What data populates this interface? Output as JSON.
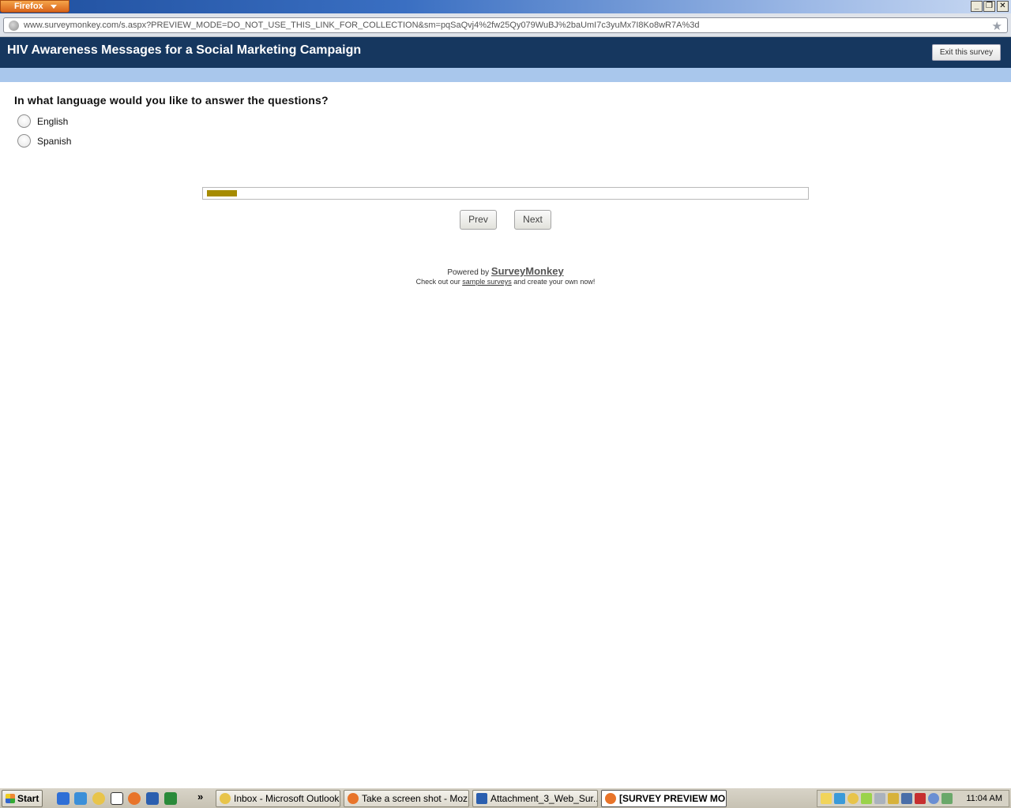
{
  "browser": {
    "menu_button": "Firefox",
    "url": "www.surveymonkey.com/s.aspx?PREVIEW_MODE=DO_NOT_USE_THIS_LINK_FOR_COLLECTION&sm=pqSaQvj4%2fw25Qy079WuBJ%2baUmI7c3yuMx7I8Ko8wR7A%3d",
    "window_controls": {
      "minimize": "_",
      "restore": "❐",
      "close": "✕"
    }
  },
  "survey": {
    "title": "HIV Awareness Messages for a Social Marketing Campaign",
    "exit_label": "Exit this survey",
    "question": "In what language would you like to answer the questions?",
    "options": [
      "English",
      "Spanish"
    ],
    "progress_fraction": 0.05,
    "prev_label": "Prev",
    "next_label": "Next"
  },
  "footer": {
    "powered_by": "Powered by",
    "brand": "SurveyMonkey",
    "checkout_prefix": "Check out our",
    "sample_link": "sample surveys",
    "checkout_suffix": "and create your own now!"
  },
  "taskbar": {
    "start_label": "Start",
    "overflow": "»",
    "tasks": [
      "Inbox - Microsoft Outlook",
      "Take a screen shot - Moz...",
      "Attachment_3_Web_Sur...",
      "[SURVEY PREVIEW MO..."
    ],
    "clock": "11:04 AM"
  }
}
